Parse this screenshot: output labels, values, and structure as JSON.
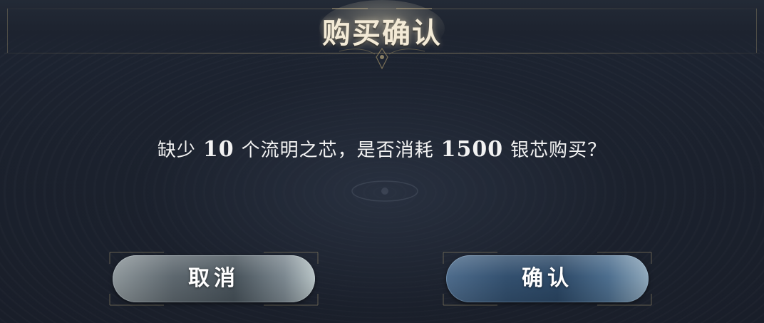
{
  "dialog": {
    "title": "购买确认",
    "message": {
      "part1": "缺少",
      "count": "10",
      "part2": "个流明之芯，是否消耗",
      "cost": "1500",
      "part3": "银芯购买？"
    },
    "buttons": {
      "cancel_label": "取消",
      "confirm_label": "确认"
    }
  },
  "colors": {
    "background": "#1b212d",
    "title": "#f3ead6",
    "text": "#f2f2f2",
    "cancel_button": "#5e686f",
    "confirm_button": "#33506f",
    "frame_gold": "#bea978"
  }
}
